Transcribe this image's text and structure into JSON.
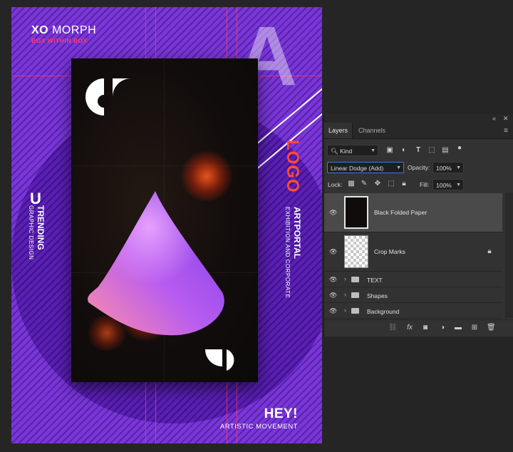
{
  "poster": {
    "brand_bold": "XO",
    "brand_rest": "MORPH",
    "tagline": "BOX WITHIN BOX",
    "big_letter": "A",
    "logo": "LOGO",
    "artportal": "ARTPORTAL",
    "exhibition": "EXHIBITION AND CORPORATE",
    "u_letter": "U",
    "trending": "TRENDING",
    "graphic_design": "GRAPHIC DESIGN",
    "hey": "HEY!",
    "artistic": "ARTISTIC MOVEMENT",
    "colors": {
      "background": "#7a36d8",
      "accent": "#ff3b6a",
      "card": "#120d0c"
    }
  },
  "panel": {
    "tabs": [
      {
        "label": "Layers",
        "active": true
      },
      {
        "label": "Channels",
        "active": false
      }
    ],
    "filter": {
      "kind": "Kind"
    },
    "blend_mode": "Linear Dodge (Add)",
    "opacity_label": "Opacity:",
    "opacity_value": "100%",
    "lock_label": "Lock:",
    "fill_label": "Fill:",
    "fill_value": "100%",
    "layers": [
      {
        "name": "Black Folded Paper",
        "type": "image",
        "selected": true,
        "visible": true
      },
      {
        "name": "Crop Marks",
        "type": "image",
        "locked": true,
        "visible": true
      },
      {
        "name": "TEXT",
        "type": "group",
        "visible": true
      },
      {
        "name": "Shapes",
        "type": "group",
        "visible": true
      },
      {
        "name": "Background",
        "type": "group",
        "visible": true
      }
    ],
    "footer_icons": [
      "link-icon",
      "fx-icon",
      "mask-icon",
      "adjustment-icon",
      "folder-icon",
      "new-layer-icon",
      "trash-icon"
    ]
  }
}
